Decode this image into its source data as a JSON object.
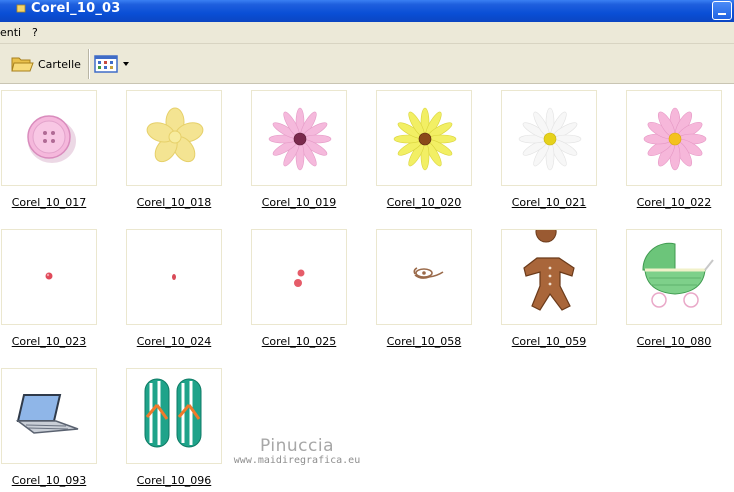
{
  "window": {
    "title": "Corel_10_03"
  },
  "menubar": {
    "items": [
      {
        "label": "enti"
      },
      {
        "label": "?"
      }
    ]
  },
  "toolbar": {
    "folders_label": "Cartelle"
  },
  "files": [
    {
      "name": "Corel_10_017",
      "icon": "pink-button-icon"
    },
    {
      "name": "Corel_10_018",
      "icon": "yellow-pale-flower-icon"
    },
    {
      "name": "Corel_10_019",
      "icon": "pink-daisy-icon"
    },
    {
      "name": "Corel_10_020",
      "icon": "yellow-daisy-icon"
    },
    {
      "name": "Corel_10_021",
      "icon": "white-daisy-icon"
    },
    {
      "name": "Corel_10_022",
      "icon": "pink-daisy-yellow-center-icon"
    },
    {
      "name": "Corel_10_023",
      "icon": "red-dot-icon"
    },
    {
      "name": "Corel_10_024",
      "icon": "small-red-dot-icon"
    },
    {
      "name": "Corel_10_025",
      "icon": "red-dots-icon"
    },
    {
      "name": "Corel_10_058",
      "icon": "brown-charm-icon"
    },
    {
      "name": "Corel_10_059",
      "icon": "gingerbread-man-icon"
    },
    {
      "name": "Corel_10_080",
      "icon": "green-pram-icon"
    },
    {
      "name": "Corel_10_093",
      "icon": "laptop-icon"
    },
    {
      "name": "Corel_10_096",
      "icon": "flip-flops-icon"
    }
  ],
  "watermark": {
    "name": "Pinuccia",
    "url": "www.maidiregrafica.eu"
  }
}
